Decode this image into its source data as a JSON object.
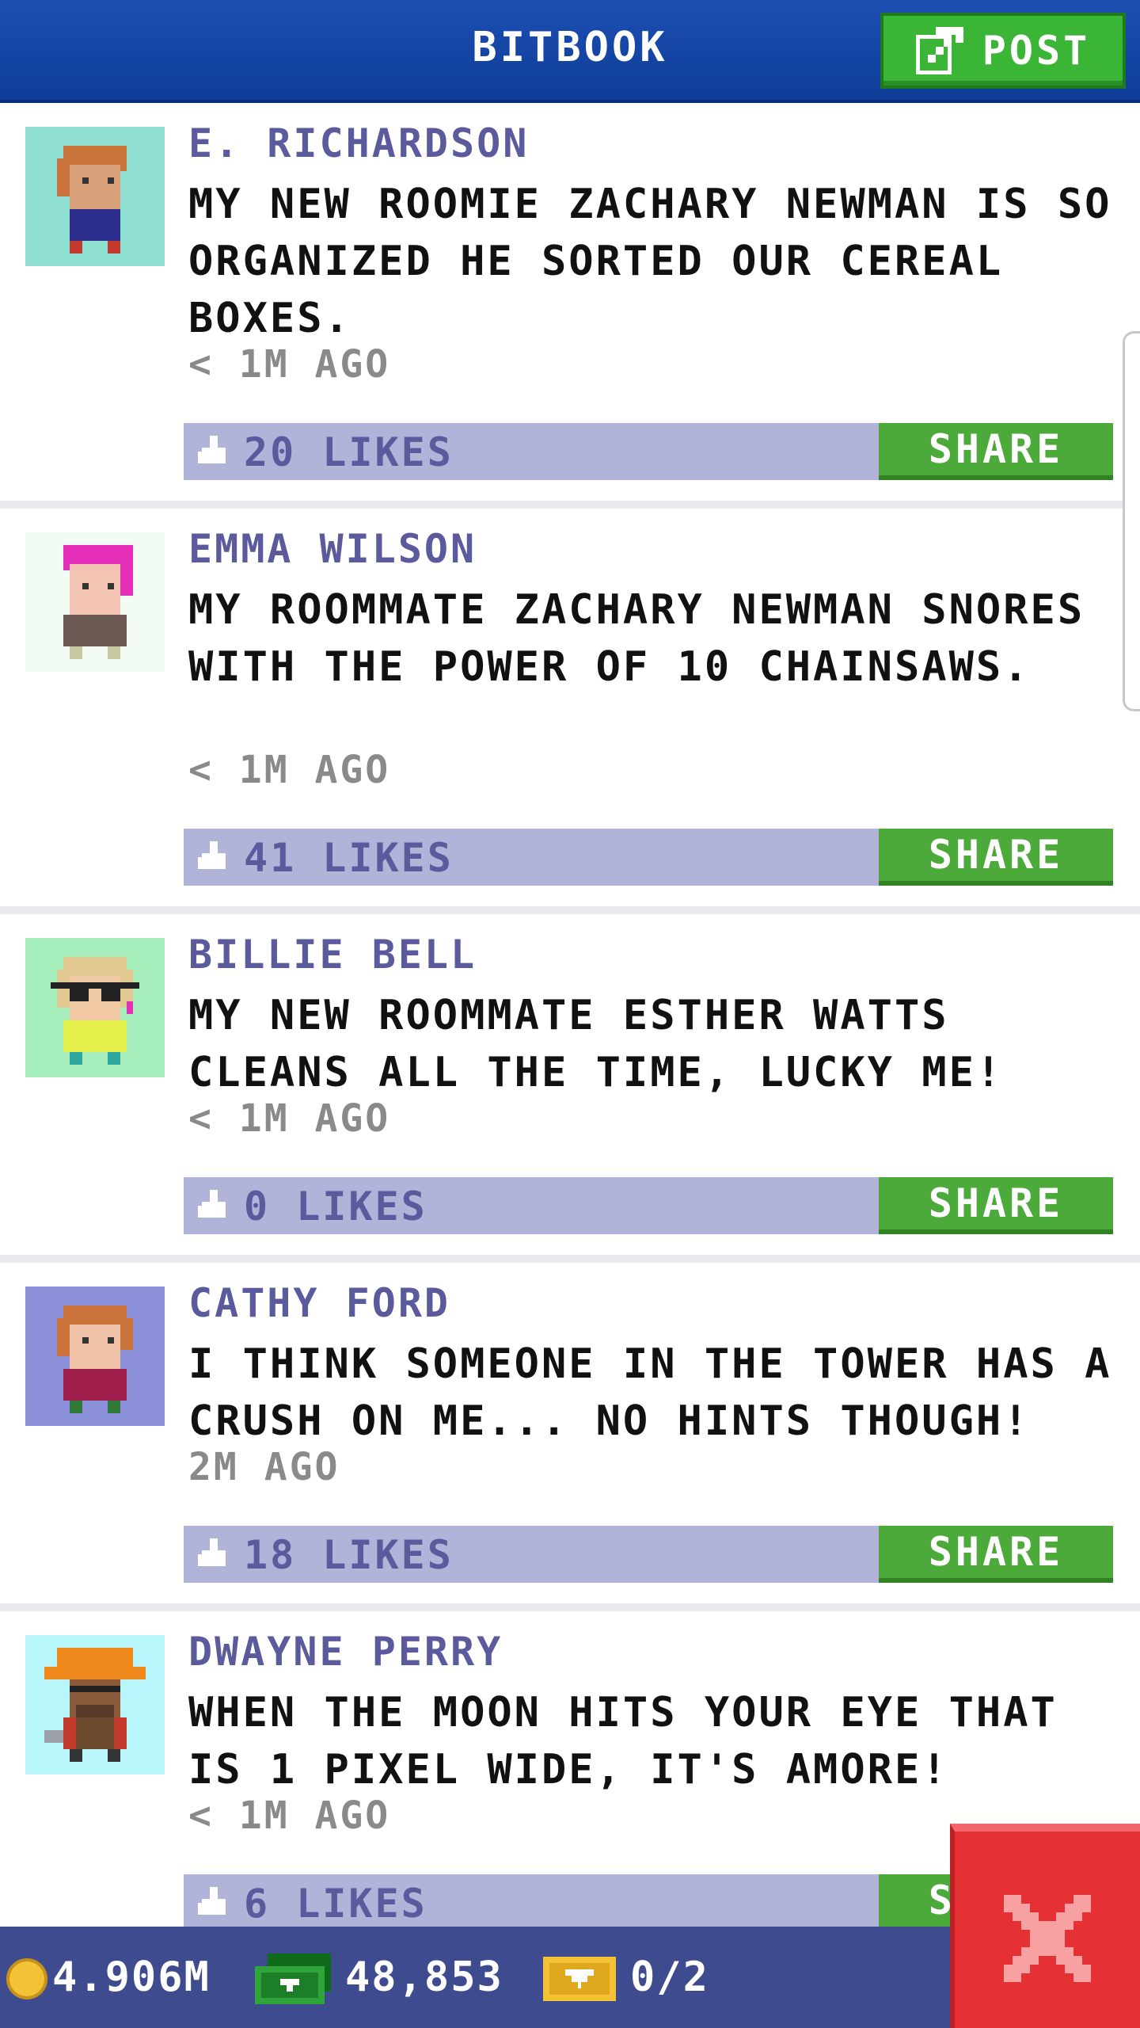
{
  "header": {
    "title": "BITBOOK",
    "post_label": "POST"
  },
  "posts": [
    {
      "name": "E. RICHARDSON",
      "text": "MY NEW ROOMIE ZACHARY NEWMAN IS SO ORGANIZED HE SORTED OUR CEREAL BOXES.",
      "time": "< 1M AGO",
      "likes": "20 LIKES",
      "share": "SHARE",
      "avatar_bg": "#8fe0d3"
    },
    {
      "name": "EMMA WILSON",
      "text": "MY ROOMMATE ZACHARY NEWMAN SNORES WITH THE POWER OF 10 CHAINSAWS.",
      "time": "< 1M AGO",
      "likes": "41 LIKES",
      "share": "SHARE",
      "avatar_bg": "#f1fbf3"
    },
    {
      "name": "BILLIE BELL",
      "text": "MY NEW ROOMMATE ESTHER WATTS CLEANS ALL THE TIME, LUCKY ME!",
      "time": "< 1M AGO",
      "likes": "0 LIKES",
      "share": "SHARE",
      "avatar_bg": "#a6efbd"
    },
    {
      "name": "CATHY FORD",
      "text": "I THINK SOMEONE IN THE TOWER HAS A CRUSH ON ME... NO HINTS THOUGH!",
      "time": "2M AGO",
      "likes": "18 LIKES",
      "share": "SHARE",
      "avatar_bg": "#8a8fd7"
    },
    {
      "name": "DWAYNE PERRY",
      "text": "WHEN THE MOON HITS YOUR EYE THAT IS 1 PIXEL WIDE, IT'S AMORE!",
      "time": "< 1M AGO",
      "likes": "6 LIKES",
      "share": "SHARE",
      "avatar_bg": "#b8f6fb"
    }
  ],
  "status": {
    "coins": "4.906M",
    "bux": "48,853",
    "tickets": "0/2"
  },
  "colors": {
    "header": "#0d3d97",
    "accent_green": "#4caa3a",
    "like_bar": "#b1b3d8",
    "name_text": "#5b5a9c",
    "close_red": "#e53034"
  },
  "icons": {
    "post": "edit-icon",
    "like": "thumbs-up-icon",
    "coin": "coin-icon",
    "bux": "bux-icon",
    "ticket": "ticket-icon",
    "close": "close-icon"
  }
}
